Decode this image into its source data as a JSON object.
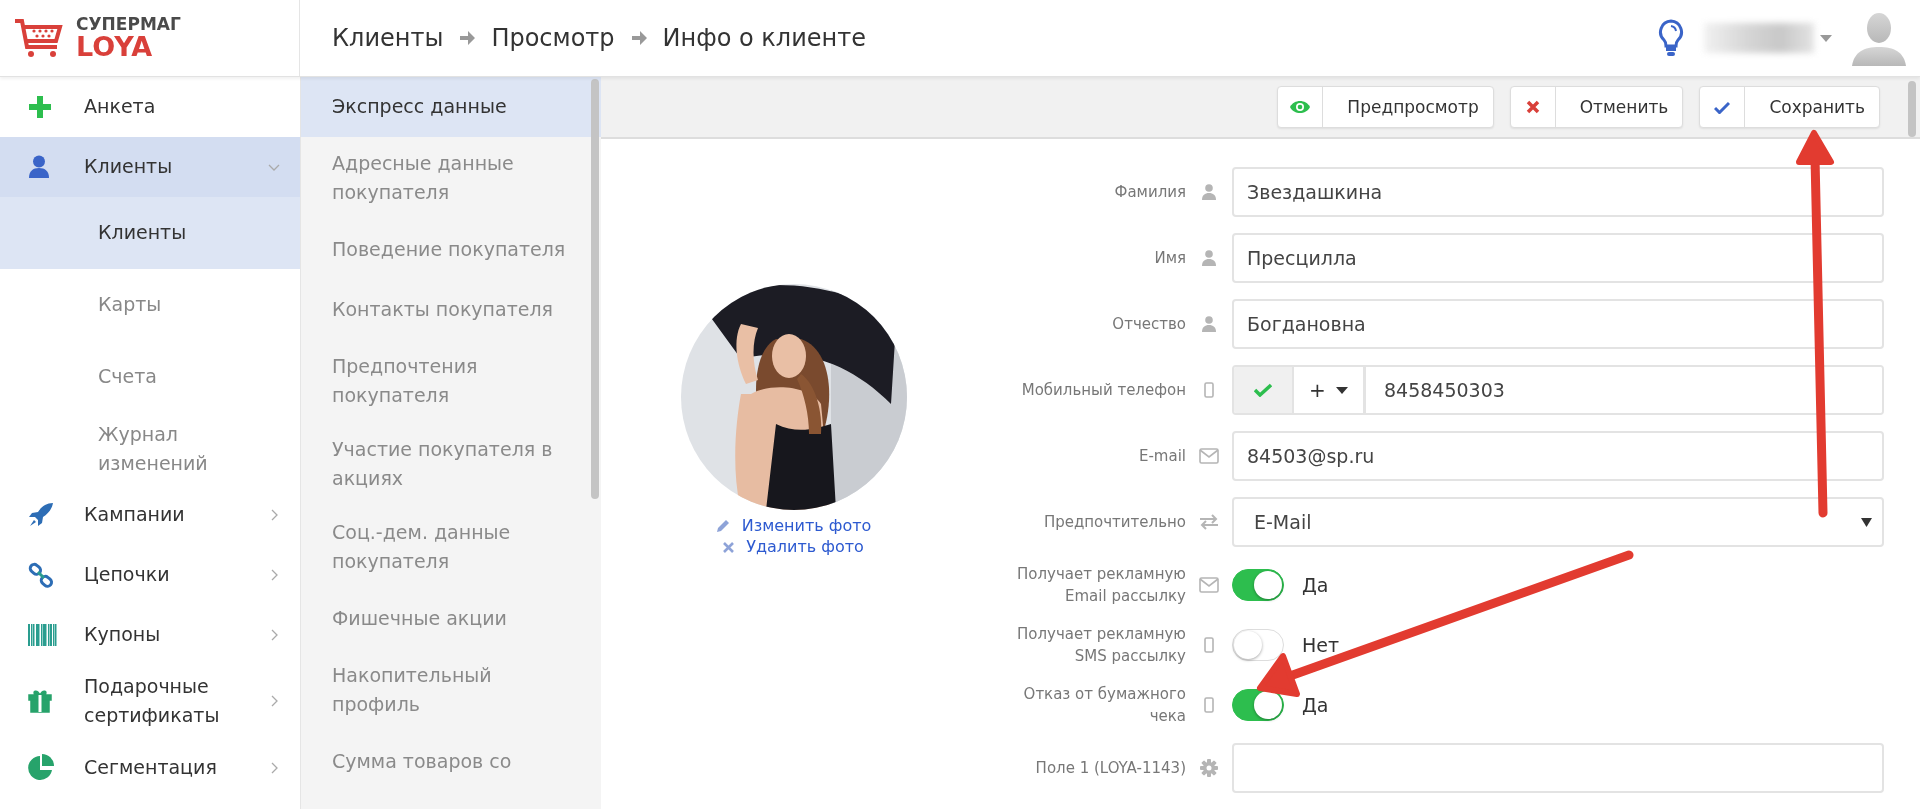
{
  "logo": {
    "top": "СУПЕРМАГ",
    "bottom": "LOYA"
  },
  "breadcrumbs": [
    "Клиенты",
    "Просмотр",
    "Инфо о клиенте"
  ],
  "nav": [
    {
      "label": "Анкета",
      "kind": "plus",
      "selected": false
    },
    {
      "label": "Клиенты",
      "kind": "user",
      "selected": true,
      "expanded": true,
      "children": [
        {
          "label": "Клиенты",
          "selected": true
        },
        {
          "label": "Карты",
          "selected": false
        },
        {
          "label": "Счета",
          "selected": false
        },
        {
          "label": "Журнал изменений",
          "selected": false
        }
      ]
    },
    {
      "label": "Кампании",
      "kind": "rocket",
      "selected": false,
      "expanded": false
    },
    {
      "label": "Цепочки",
      "kind": "link",
      "selected": false,
      "expanded": false
    },
    {
      "label": "Купоны",
      "kind": "barcode",
      "selected": false,
      "expanded": false
    },
    {
      "label": "Подарочные сертификаты",
      "kind": "gift",
      "selected": false,
      "expanded": false
    },
    {
      "label": "Сегментация",
      "kind": "pie",
      "selected": false,
      "expanded": false
    }
  ],
  "sections": [
    {
      "label": "Экспресс данные",
      "selected": true
    },
    {
      "label": "Адресные данные покупателя",
      "selected": false
    },
    {
      "label": "Поведение покупателя",
      "selected": false
    },
    {
      "label": "Контакты покупателя",
      "selected": false
    },
    {
      "label": "Предпочтения покупателя",
      "selected": false
    },
    {
      "label": "Участие покупателя в акциях",
      "selected": false
    },
    {
      "label": "Соц.-дем. данные покупателя",
      "selected": false
    },
    {
      "label": "Фишечные акции",
      "selected": false
    },
    {
      "label": "Накопительный профиль",
      "selected": false
    },
    {
      "label": "Сумма товаров со",
      "selected": false
    }
  ],
  "toolbar": [
    {
      "label": "Предпросмотр",
      "kind": "preview"
    },
    {
      "label": "Отменить",
      "kind": "cancel"
    },
    {
      "label": "Сохранить",
      "kind": "save"
    }
  ],
  "photo": {
    "kind": "picture",
    "actions": [
      {
        "label": "Изменить фото",
        "kind": "edit"
      },
      {
        "label": "Удалить фото",
        "kind": "delete"
      }
    ]
  },
  "form": [
    {
      "kind": "text",
      "label": "Фамилия",
      "value": "Звездашкина"
    },
    {
      "kind": "text",
      "label": "Имя",
      "value": "Пресцилла"
    },
    {
      "kind": "text",
      "label": "Отчество",
      "value": "Богдановна"
    },
    {
      "kind": "phone",
      "label": "Мобильный телефон",
      "verified": true,
      "prefix": "+",
      "value": "8458450303"
    },
    {
      "kind": "text",
      "label": "E-mail",
      "value": "84503@sp.ru"
    },
    {
      "kind": "select",
      "label": "Предпочтительно",
      "value": "E-Mail"
    },
    {
      "kind": "toggle",
      "label": "Получает рекламную Email рассылку",
      "on": true,
      "state_label": "Да"
    },
    {
      "kind": "toggle",
      "label": "Получает рекламную SMS рассылку",
      "on": false,
      "state_label": "Нет"
    },
    {
      "kind": "toggle",
      "label": "Отказ от бумажного чека",
      "on": true,
      "state_label": "Да"
    },
    {
      "kind": "text",
      "label": "Поле 1 (LOYA-1143)"
    }
  ]
}
